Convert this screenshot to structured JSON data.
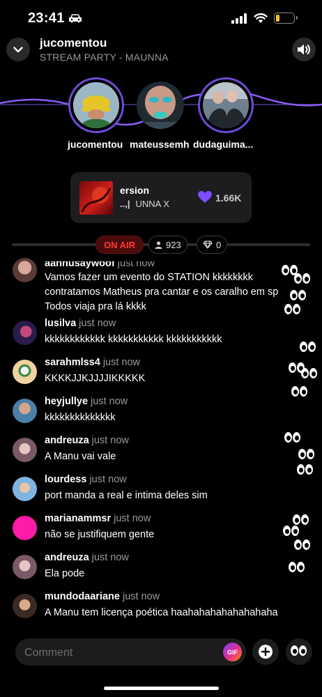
{
  "status_bar": {
    "time": "23:41"
  },
  "header": {
    "host": "jucomentou",
    "title": "STREAM PARTY - MAUNNA"
  },
  "speakers": [
    {
      "name": "jucomentou"
    },
    {
      "name": "mateussemh"
    },
    {
      "name": "dudaguima..."
    }
  ],
  "now_playing": {
    "title": "ersion",
    "artist": "UNNA X",
    "artist_prefix": "..,|",
    "likes": "1.66K"
  },
  "live": {
    "label": "ON AIR",
    "viewers": "923",
    "gems": "0"
  },
  "chat": [
    {
      "user": "aannusaywoof",
      "time": "just now",
      "lines": [
        "Vamos fazer um evento do STATION kkkkkkkk",
        "contratamos Matheus pra cantar e os caralho em sp",
        "Todos viaja pra lá kkkk"
      ]
    },
    {
      "user": "lusilva",
      "time": "just now",
      "lines": [
        "kkkkkkkkkkkk kkkkkkkkkkk kkkkkkkkkkk"
      ]
    },
    {
      "user": "sarahmlss4",
      "time": "just now",
      "lines": [
        "KKKKJJKJJJJIKKKKK"
      ]
    },
    {
      "user": "heyjullye",
      "time": "just now",
      "lines": [
        "kkkkkkkkkkkkkk"
      ]
    },
    {
      "user": "andreuza",
      "time": "just now",
      "lines": [
        "A Manu vai vale"
      ]
    },
    {
      "user": "lourdess",
      "time": "just now",
      "lines": [
        "port manda a real e intima deles sim"
      ]
    },
    {
      "user": "marianammsr",
      "time": "just now",
      "lines": [
        "não se justifiquem gente"
      ]
    },
    {
      "user": "andreuza",
      "time": "just now",
      "lines": [
        "Ela pode"
      ]
    },
    {
      "user": "mundodaariane",
      "time": "just now",
      "lines": [
        "A Manu tem licença poética haahahahahahahahaha"
      ]
    }
  ],
  "composer": {
    "placeholder": "Comment",
    "gif_label": "GIF"
  },
  "colors": {
    "accent": "#6f4bd6",
    "live_red": "#ff3b30",
    "heart": "#7c4dff"
  }
}
